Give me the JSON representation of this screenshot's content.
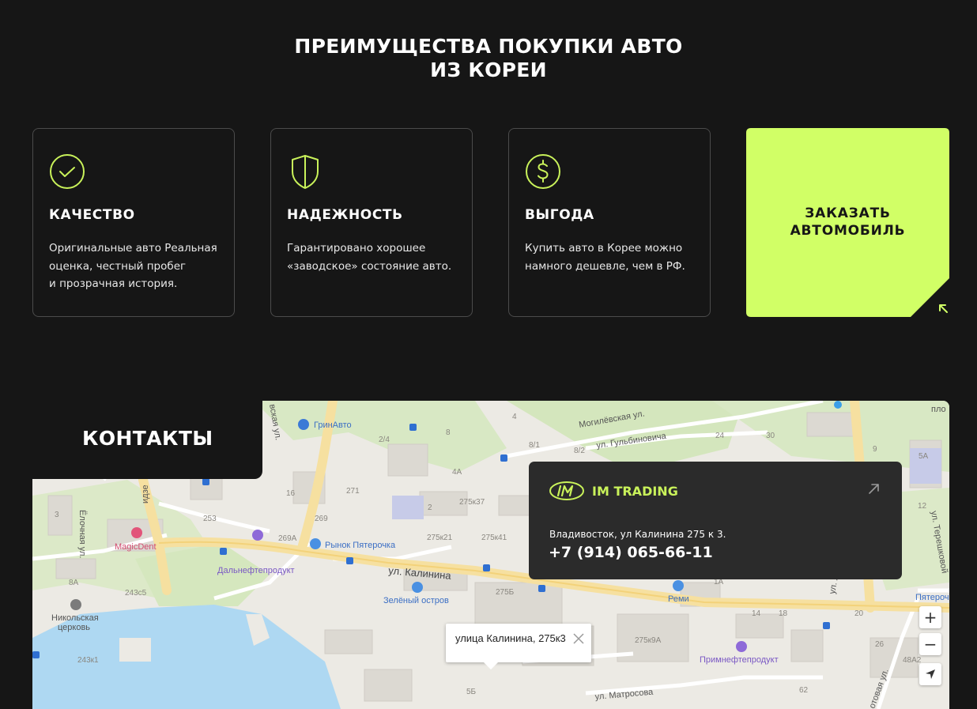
{
  "advantages": {
    "title_line1": "ПРЕИМУЩЕСТВА ПОКУПКИ АВТО",
    "title_line2": "ИЗ КОРЕИ",
    "cards": [
      {
        "icon": "check-circle-icon",
        "title": "КАЧЕСТВО",
        "lines": [
          "Оригинальные авто Реальная",
          "оценка, честный пробег",
          "и прозрачная история."
        ]
      },
      {
        "icon": "shield-icon",
        "title": "НАДЕЖНОСТЬ",
        "lines": [
          "Гарантировано хорошее",
          "«заводское» состояние авто."
        ]
      },
      {
        "icon": "dollar-circle-icon",
        "title": "ВЫГОДА",
        "lines": [
          "Купить авто в Корее можно",
          "намного дешевле, чем в РФ."
        ]
      }
    ],
    "cta": {
      "line1": "ЗАКАЗАТЬ",
      "line2": "АВТОМОБИЛЬ",
      "icon": "arrow-up-left-icon"
    }
  },
  "contacts": {
    "title": "КОНТАКТЫ",
    "brand": "IM TRADING",
    "address": "Владивосток, ул Калинина 275 к 3.",
    "phone": "+7 (914) 065-66-11"
  },
  "map": {
    "balloon_text": "улица Калинина, 275к3",
    "controls": {
      "zoom_in": "+",
      "zoom_out": "−"
    },
    "labels": {
      "street_kalinina": "ул. Калинина",
      "street_mogilevskaya": "Могилёвская ул.",
      "street_gulbinovicha": "ул. Гульбиновича",
      "street_matrosova": "ул. Матросова",
      "street_elochnaya": "Ёлочная ул.",
      "street_tereshkovoi": "ул. Терешковой",
      "street_vertical_top": "вская ул.",
      "street_vertical_lazo": "идзе",
      "street_vertical_right": "ул. Л",
      "street_vertical_bottomright": "отовая ул.",
      "poi_grinavto": "ГринАвто",
      "poi_rynok": "Рынок Пятерочка",
      "poi_magicdent": "MagicDent",
      "poi_dalneft": "Дальнефтепродукт",
      "poi_zeleny": "Зелёный остров",
      "poi_remi": "Реми",
      "poi_primneft": "Примнефтепродукт",
      "poi_pyaterochka": "Пятерочка",
      "poi_church1": "Никольская",
      "poi_church2": "церковь",
      "poi_plo": "пло",
      "h_24": "24",
      "h_30": "30",
      "h_8_1": "8/1",
      "h_8_2": "8/2",
      "h_2_4": "2/4",
      "h_8": "8",
      "h_4": "4",
      "h_4a": "4А",
      "h_275k37": "275к37",
      "h_275k21": "275к21",
      "h_275k41": "275к41",
      "h_275b": "275Б",
      "h_275k9a": "275к9А",
      "h_271": "271",
      "h_269": "269",
      "h_269a": "269А",
      "h_253": "253",
      "h_16": "16",
      "h_2": "2",
      "h_243s5": "243с5",
      "h_243k1": "243к1",
      "h_8a": "8А",
      "h_5b": "5Б",
      "h_5a": "5А",
      "h_14": "14",
      "h_18": "18",
      "h_20": "20",
      "h_26": "26",
      "h_48a2": "48А2",
      "h_62": "62",
      "h_12": "12",
      "h_1a": "1А",
      "h_3": "3",
      "h_9": "9"
    }
  }
}
